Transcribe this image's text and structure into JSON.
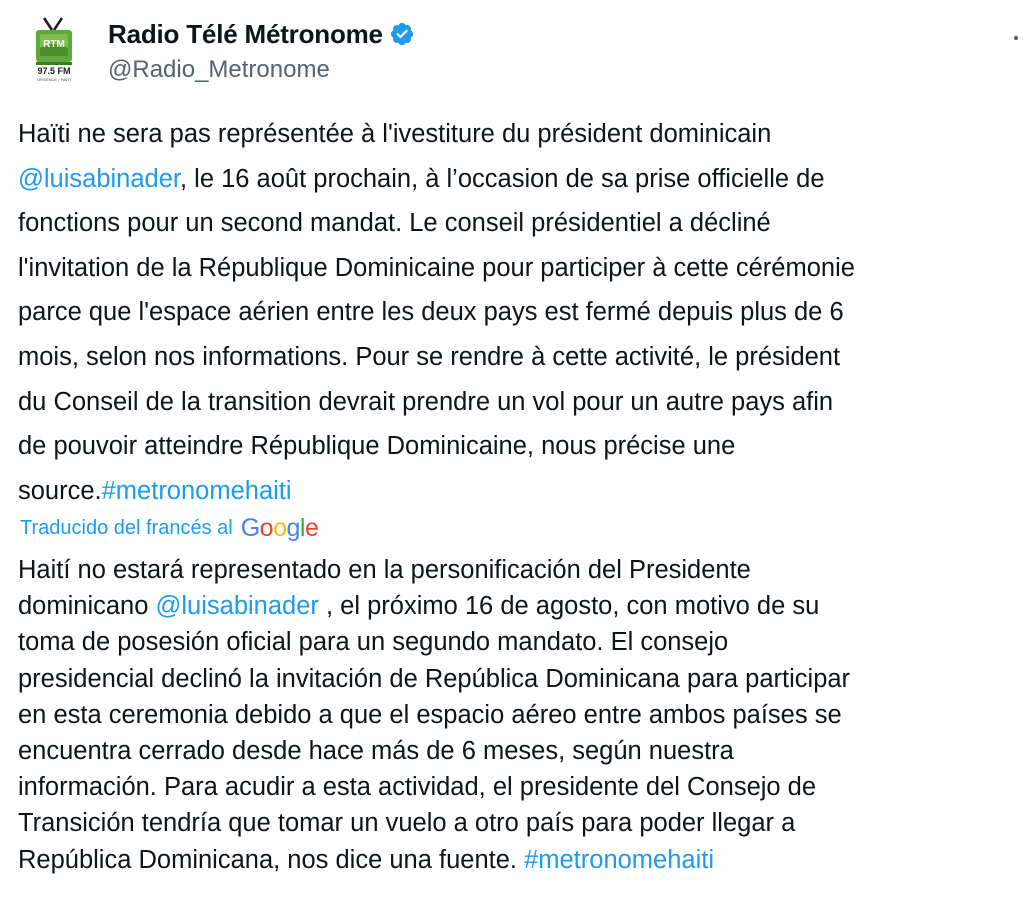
{
  "author": {
    "display_name": "Radio Télé Métronome",
    "handle": "@Radio_Metronome",
    "verified": true,
    "avatar": {
      "name": "rtm-logo",
      "badge": "RTM",
      "frequency": "97.5 FM",
      "tagline": "URGENCE • HAITI"
    }
  },
  "colors": {
    "link": "#1d9bf0",
    "text": "#0f1419",
    "secondary": "#536471",
    "logo_green": "#6ab04c"
  },
  "tweet": {
    "lines": [
      {
        "parts": [
          {
            "text": "Haïti ne sera pas représentée à l'ivestiture du président dominicain"
          }
        ]
      },
      {
        "parts": [
          {
            "text": "@luisabinader",
            "type": "mention"
          },
          {
            "text": ", le 16 août prochain, à l’occasion de sa prise officielle de"
          }
        ]
      },
      {
        "parts": [
          {
            "text": "fonctions pour un second mandat. Le conseil présidentiel a décliné"
          }
        ]
      },
      {
        "parts": [
          {
            "text": "l'invitation de la République Dominicaine pour participer à cette cérémonie"
          }
        ]
      },
      {
        "parts": [
          {
            "text": "parce que l'espace aérien entre les deux pays est fermé depuis plus de 6"
          }
        ]
      },
      {
        "parts": [
          {
            "text": "mois, selon nos informations. Pour se rendre à cette activité, le président"
          }
        ]
      },
      {
        "parts": [
          {
            "text": "du Conseil de la transition devrait prendre un vol pour un autre pays afin"
          }
        ]
      },
      {
        "parts": [
          {
            "text": "de pouvoir atteindre République Dominicaine, nous précise une"
          }
        ]
      },
      {
        "parts": [
          {
            "text": "source."
          },
          {
            "text": "#metronomehaiti",
            "type": "hashtag"
          }
        ]
      }
    ]
  },
  "translation": {
    "label": "Traducido del francés al",
    "provider": "Google",
    "lines": [
      {
        "parts": [
          {
            "text": "Haití no estará representado en la personificación del Presidente"
          }
        ]
      },
      {
        "parts": [
          {
            "text": "dominicano "
          },
          {
            "text": "@luisabinader",
            "type": "mention"
          },
          {
            "text": " , el próximo 16 de agosto, con motivo de su"
          }
        ]
      },
      {
        "parts": [
          {
            "text": "toma de posesión oficial para un segundo mandato. El consejo"
          }
        ]
      },
      {
        "parts": [
          {
            "text": "presidencial declinó la invitación de República Dominicana para participar"
          }
        ]
      },
      {
        "parts": [
          {
            "text": "en esta ceremonia debido a que el espacio aéreo entre ambos países se"
          }
        ]
      },
      {
        "parts": [
          {
            "text": "encuentra cerrado desde hace más de 6 meses, según nuestra"
          }
        ]
      },
      {
        "parts": [
          {
            "text": "información. Para acudir a esta actividad, el presidente del Consejo de"
          }
        ]
      },
      {
        "parts": [
          {
            "text": "Transición tendría que tomar un vuelo a otro país para poder llegar a"
          }
        ]
      },
      {
        "parts": [
          {
            "text": "República Dominicana, nos dice una fuente. "
          },
          {
            "text": "#metronomehaiti",
            "type": "hashtag"
          }
        ]
      }
    ]
  }
}
